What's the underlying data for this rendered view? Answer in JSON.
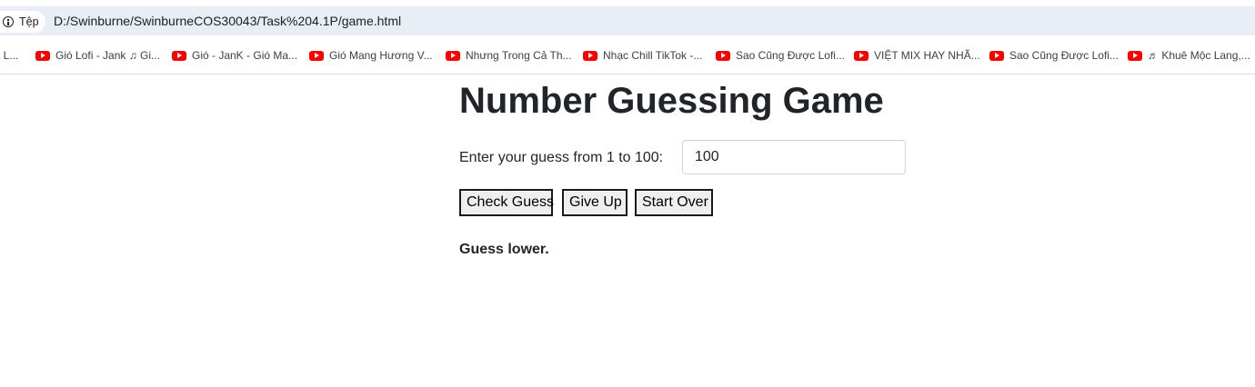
{
  "browser": {
    "site_info_label": "Tệp",
    "url": "D:/Swinburne/SwinburneCOS30043/Task%204.1P/game.html"
  },
  "bookmarks": [
    {
      "label": "t L...",
      "icon": "none"
    },
    {
      "label": "Gió Lofi - Jank ♫ Gi...",
      "icon": "youtube-icon"
    },
    {
      "label": "Gió - JanK - Gió Ma...",
      "icon": "youtube-icon"
    },
    {
      "label": "Gió Mang Hương V...",
      "icon": "youtube-icon"
    },
    {
      "label": "Nhưng Trong Cả Th...",
      "icon": "youtube-icon"
    },
    {
      "label": "Nhạc Chill TikTok -...",
      "icon": "youtube-icon"
    },
    {
      "label": "Sao Cũng Được Lofi...",
      "icon": "youtube-icon"
    },
    {
      "label": "VIỆT MIX HAY NHÃ...",
      "icon": "youtube-icon"
    },
    {
      "label": "Sao Cũng Được Lofi...",
      "icon": "youtube-icon"
    },
    {
      "label": "♬ Khuê Mộc Lang,...",
      "icon": "youtube-icon"
    }
  ],
  "game": {
    "title": "Number Guessing Game",
    "prompt_label": "Enter your guess from 1 to 100:",
    "guess_value": "100",
    "buttons": {
      "check": "Check Guess",
      "give_up": "Give Up",
      "start_over": "Start Over"
    },
    "result_message": "Guess lower."
  },
  "colors": {
    "url_strip_bg": "#e9edf5",
    "youtube_red": "#ff0000",
    "text_dark": "#212529",
    "button_bg": "#efefef"
  }
}
